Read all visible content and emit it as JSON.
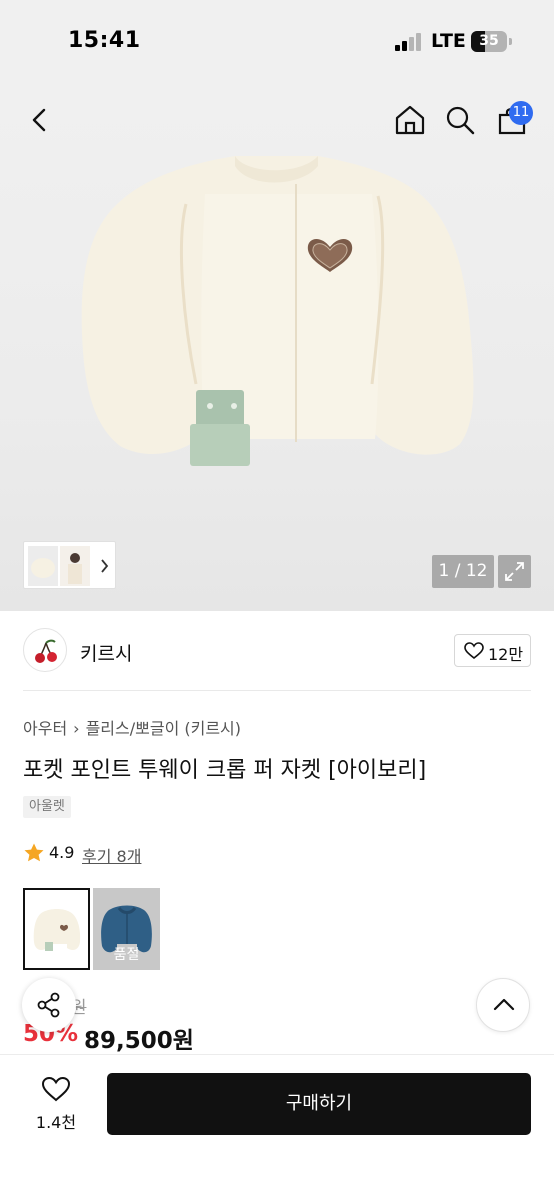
{
  "status_bar": {
    "time": "15:41",
    "network": "LTE",
    "battery": "35"
  },
  "nav": {
    "back_icon": "chevron-left-icon",
    "home_icon": "home-icon",
    "search_icon": "search-icon",
    "cart_icon": "shopping-bag-icon",
    "cart_count": "11"
  },
  "gallery": {
    "counter": "1 / 12",
    "expand_icon": "expand-icon"
  },
  "brand": {
    "name": "키르시",
    "like_count": "12만"
  },
  "product": {
    "breadcrumb": [
      "아우터",
      "플리스/뽀글이 (키르시)"
    ],
    "title": "포켓 포인트 투웨이 크롭 퍼 자켓 [아이보리]",
    "tag": "아울렛",
    "rating": "4.9",
    "review_link": "후기 8개",
    "swatch_soldout": "품절",
    "original_price": "0원",
    "discount": "50%",
    "price": "89,500원"
  },
  "bottom_bar": {
    "wish_count": "1.4천",
    "buy_label": "구매하기"
  },
  "colors": {
    "accent_blue": "#2f6bf0",
    "discount_red": "#e8313b",
    "buy_button": "#111111"
  }
}
